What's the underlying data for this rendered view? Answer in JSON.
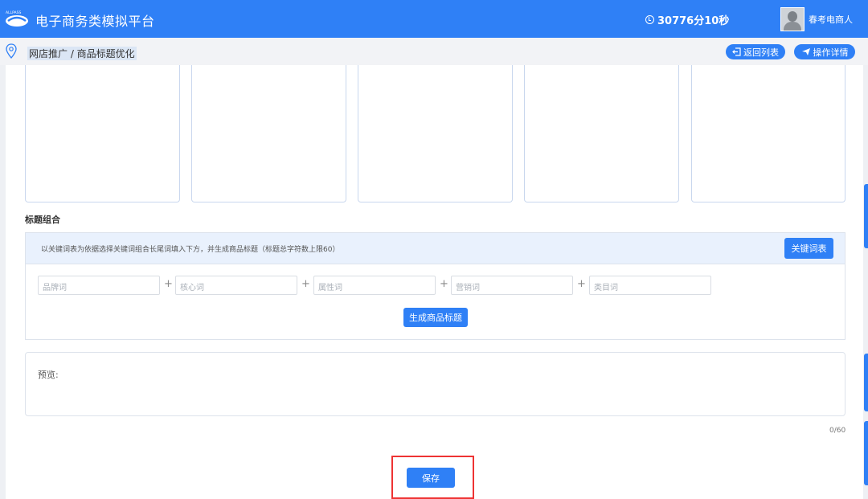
{
  "header": {
    "app_title": "电子商务类模拟平台",
    "logo_text": "ALLPASS",
    "timer": "30776分10秒",
    "username": "春考电商人"
  },
  "breadcrumb": {
    "path": "网店推广 / 商品标题优化"
  },
  "header_actions": {
    "back_label": "返回列表",
    "detail_label": "操作详情"
  },
  "title_section": {
    "heading": "标题组合",
    "notice": "以关键词表为依据选择关键词组合长尾词填入下方，并生成商品标题（标题总字符数上限60）",
    "keyword_table_button": "关键词表",
    "fields": [
      {
        "placeholder": "品牌词"
      },
      {
        "placeholder": "核心词"
      },
      {
        "placeholder": "属性词"
      },
      {
        "placeholder": "营销词"
      },
      {
        "placeholder": "类目词"
      }
    ],
    "plus_sign": "+",
    "generate_button": "生成商品标题"
  },
  "preview": {
    "label": "预览:",
    "counter": "0/60"
  },
  "footer": {
    "save_button": "保存"
  },
  "colors": {
    "primary": "#2f80f6",
    "highlight": "#e33333"
  }
}
